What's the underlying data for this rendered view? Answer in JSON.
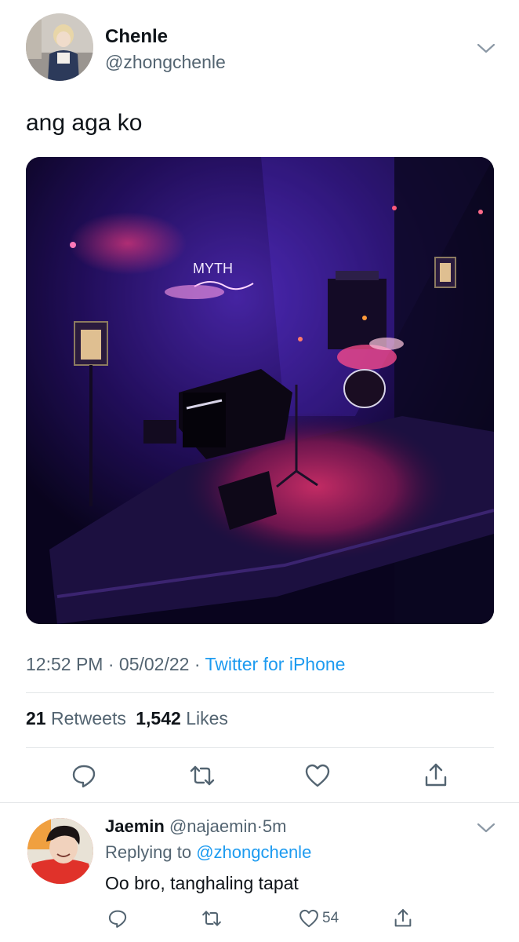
{
  "tweet": {
    "author_name": "Chenle",
    "author_handle": "@zhongchenle",
    "text": "ang aga ko",
    "media_caption": "MYTH",
    "time": "12:52 PM",
    "date": "05/02/22",
    "dot": "·",
    "source": "Twitter for iPhone",
    "retweet_count": "21",
    "retweet_label": "Retweets",
    "like_count": "1,542",
    "like_label": "Likes"
  },
  "actions": {
    "reply_icon": "reply-bubble-icon",
    "retweet_icon": "retweet-icon",
    "like_icon": "heart-icon",
    "share_icon": "share-icon"
  },
  "reply": {
    "author_name": "Jaemin",
    "author_handle": "@najaemin",
    "dot": "·",
    "time_ago": "5m",
    "replying_prefix": "Replying to",
    "replying_to": "@zhongchenle",
    "text": "Oo bro, tanghaling tapat",
    "like_count": "54"
  },
  "colors": {
    "accent": "#1d9bf0",
    "secondary_text": "#536471",
    "primary_text": "#0f1419",
    "divider": "#e3e6e8"
  }
}
